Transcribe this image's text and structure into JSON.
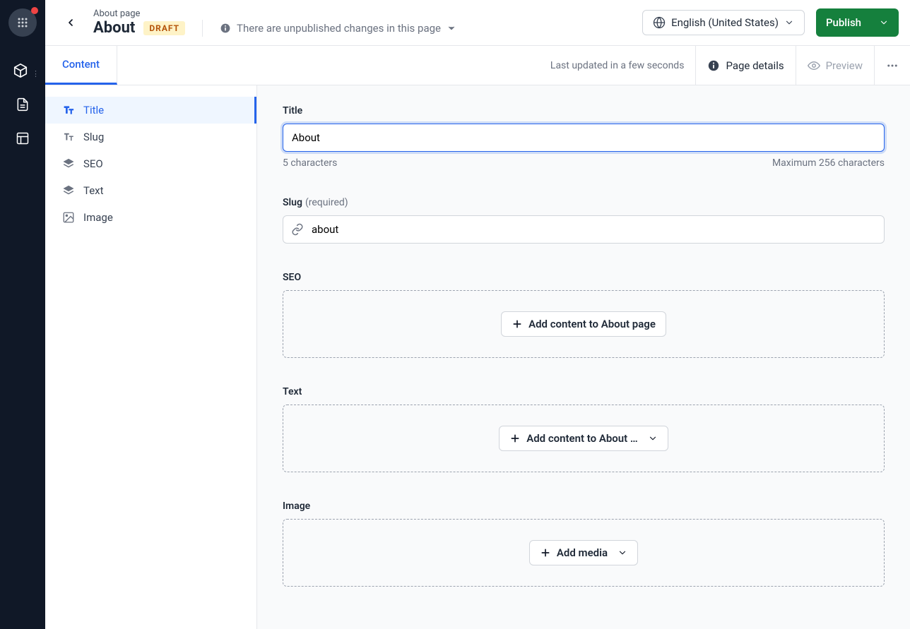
{
  "header": {
    "breadcrumb": "About page",
    "title": "About",
    "status_badge": "DRAFT",
    "unpublished_note": "There are unpublished changes in this page",
    "language": "English (United States)",
    "publish_label": "Publish"
  },
  "tabs": {
    "content": "Content",
    "last_updated": "Last updated in a few seconds",
    "page_details": "Page details",
    "preview": "Preview"
  },
  "sidenav": {
    "items": [
      {
        "label": "Title"
      },
      {
        "label": "Slug"
      },
      {
        "label": "SEO"
      },
      {
        "label": "Text"
      },
      {
        "label": "Image"
      }
    ]
  },
  "fields": {
    "title": {
      "label": "Title",
      "value": "About",
      "count_text": "5 characters",
      "max_text": "Maximum 256 characters"
    },
    "slug": {
      "label": "Slug",
      "required": "(required)",
      "value": "about"
    },
    "seo": {
      "label": "SEO",
      "button": "Add content to About page"
    },
    "text": {
      "label": "Text",
      "button": "Add content to About …"
    },
    "image": {
      "label": "Image",
      "button": "Add media"
    }
  }
}
